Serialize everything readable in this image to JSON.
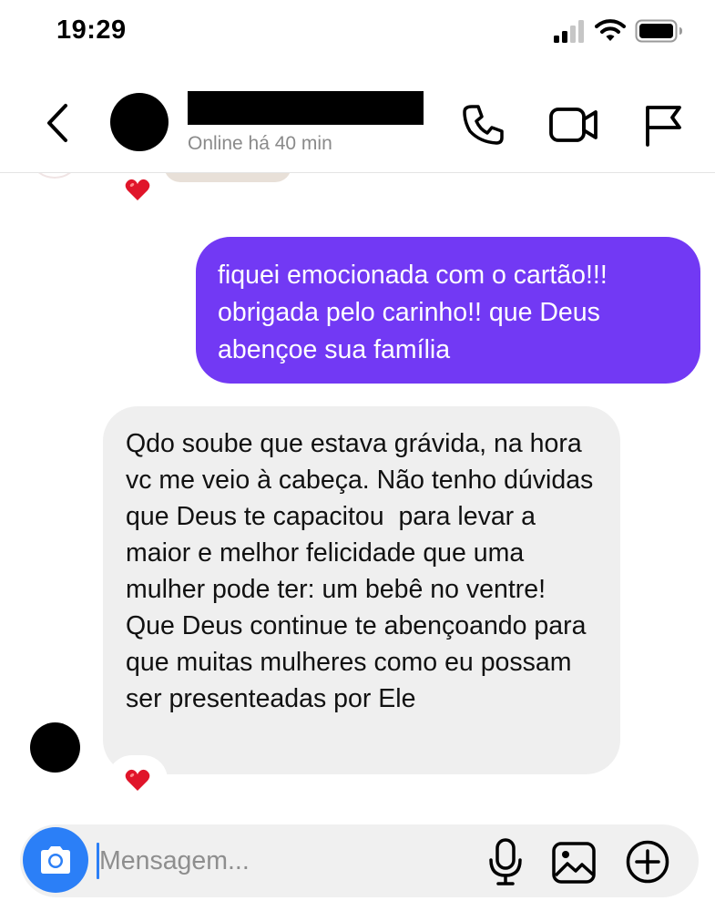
{
  "status_bar": {
    "time": "19:29",
    "icons": [
      "signal-icon",
      "wifi-icon",
      "battery-icon"
    ]
  },
  "header": {
    "back_icon": "chevron-left-icon",
    "contact_status": "Online há 40 min",
    "actions": [
      "phone-icon",
      "video-camera-icon",
      "flag-icon"
    ]
  },
  "conversation": {
    "top_reaction": "❤️",
    "sent_message": "fiquei emocionada com o cartão!!! obrigada pelo carinho!! que Deus abençoe sua família",
    "received_message": "Qdo soube que estava grávida, na hora vc me veio à cabeça. Não tenho dúvidas que Deus te capacitou  para levar a maior e melhor felicidade que uma mulher pode ter: um bebê no ventre! Que Deus continue te abençoando para que muitas mulheres como eu possam ser presenteadas por Ele",
    "bottom_reaction": "❤️"
  },
  "composer": {
    "placeholder": "Mensagem...",
    "value": "",
    "icons": [
      "camera-icon",
      "microphone-icon",
      "image-icon",
      "plus-circle-icon"
    ]
  },
  "colors": {
    "sent_bubble": "#7239f4",
    "received_bubble": "#efefef",
    "camera_button": "#2b7ff7",
    "heart": "#e0152a"
  }
}
